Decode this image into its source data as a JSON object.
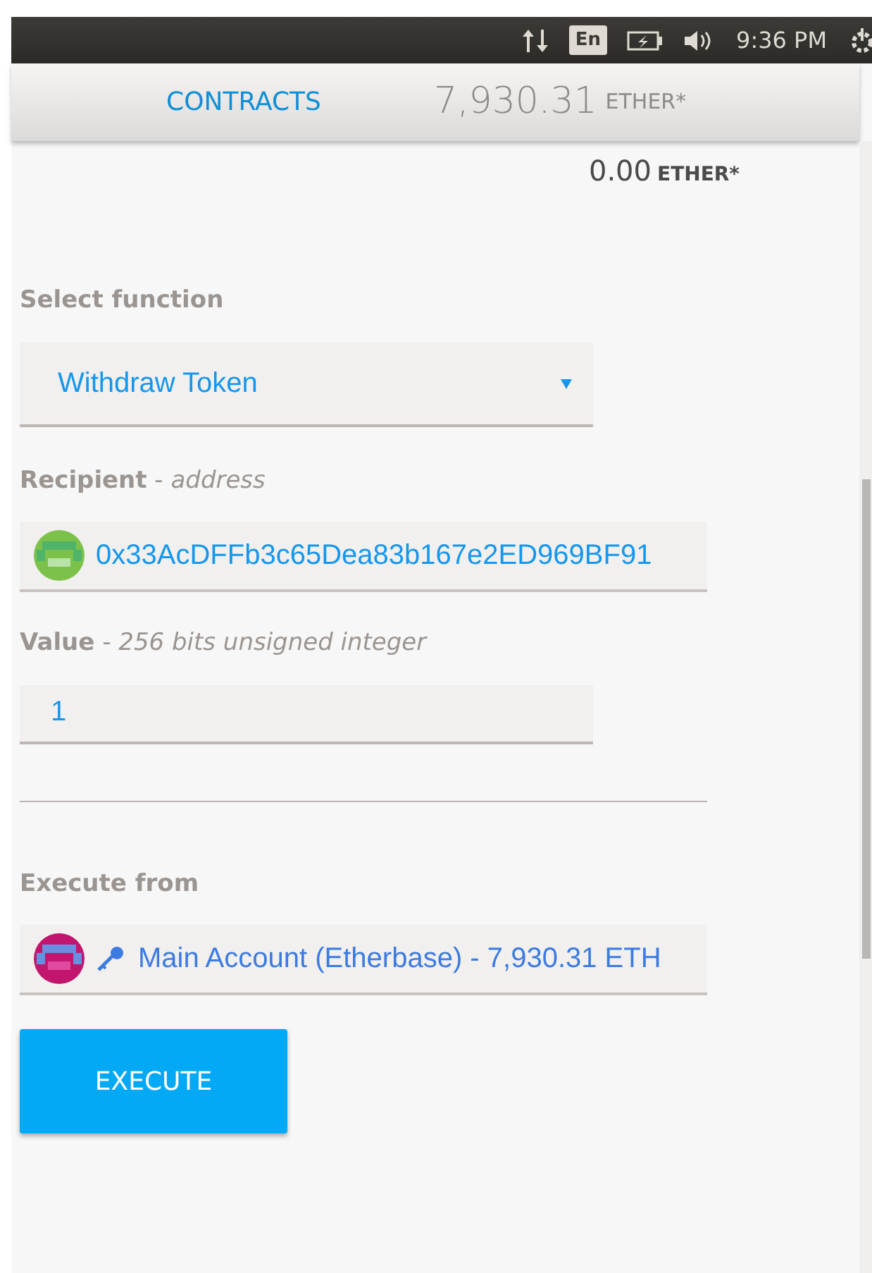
{
  "status_bar": {
    "keyboard": "En",
    "time": "9:36 PM"
  },
  "header": {
    "title": "CONTRACTS",
    "balance": "7,930.31",
    "unit": "ETHER*"
  },
  "balance": {
    "amount": "0.00",
    "unit": "ETHER*"
  },
  "function_select": {
    "label": "Select function",
    "value": "Withdraw Token"
  },
  "fields": [
    {
      "kind": "address",
      "label": "**Recipient** - *address*",
      "value": "0x33AcDFFb3c65Dea83b167e2ED969BF91"
    },
    {
      "kind": "number",
      "label": "**Value** - *256 bits unsigned integer*",
      "value": "1"
    }
  ],
  "execute_from": {
    "label": "Execute from",
    "account": "Main Account (Etherbase) - 7,930.31 ETH"
  },
  "execute_button": "EXECUTE"
}
